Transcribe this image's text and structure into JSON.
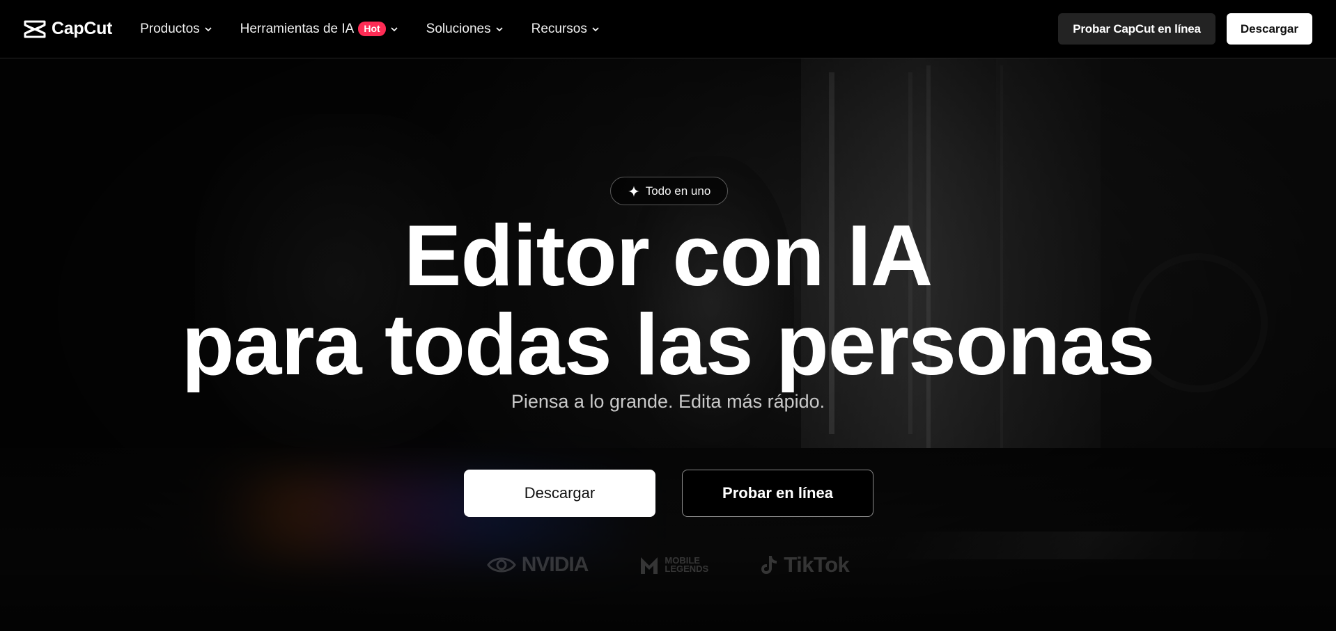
{
  "header": {
    "brand": "CapCut",
    "nav": [
      {
        "label": "Productos"
      },
      {
        "label": "Herramientas de IA",
        "badge": "Hot"
      },
      {
        "label": "Soluciones"
      },
      {
        "label": "Recursos"
      }
    ],
    "try_online_label": "Probar CapCut en línea",
    "download_label": "Descargar"
  },
  "hero": {
    "pill_label": "Todo en uno",
    "headline_line1": "Editor con IA",
    "headline_line2": "para todas las personas",
    "subtitle": "Piensa a lo grande. Edita más rápido.",
    "download_button": "Descargar",
    "try_online_button": "Probar en línea"
  },
  "partners": [
    {
      "name": "NVIDIA",
      "icon": "nvidia-logo"
    },
    {
      "name_line1": "MOBILE",
      "name_line2": "LEGENDS",
      "icon": "mobile-legends-logo"
    },
    {
      "name": "TikTok",
      "icon": "tiktok-logo"
    }
  ],
  "colors": {
    "background": "#000000",
    "hot_badge": "#fe2c55",
    "header_dark_button": "#232323",
    "light_button": "#ffffff"
  }
}
